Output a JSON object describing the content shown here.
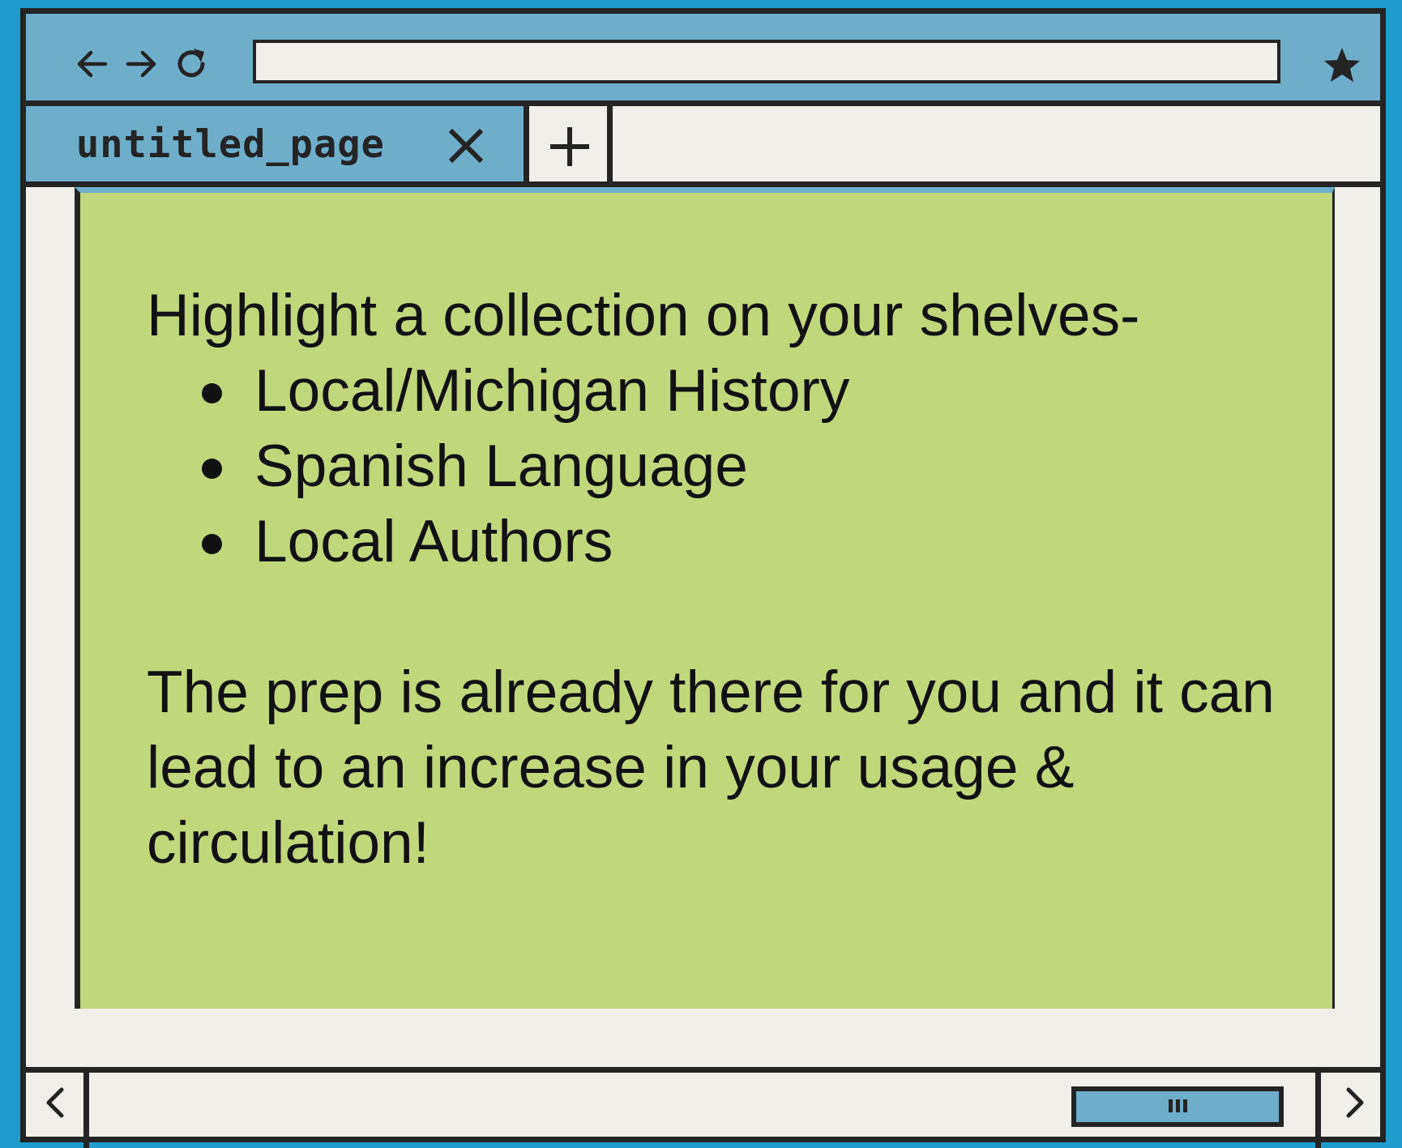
{
  "browser": {
    "address_bar": {
      "value": "",
      "placeholder": ""
    },
    "icons": {
      "back": "arrow-left-icon",
      "forward": "arrow-right-icon",
      "reload": "reload-icon",
      "bookmark": "star-icon",
      "close_tab": "close-icon",
      "new_tab": "plus-icon",
      "scroll_left": "chevron-left-icon",
      "scroll_right": "chevron-right-icon",
      "scroll_thumb_grip": "grip-icon"
    },
    "tabs": [
      {
        "label": "untitled_page",
        "active": true
      }
    ]
  },
  "content": {
    "heading": "Highlight a collection on your shelves-",
    "bullets": [
      "Local/Michigan History",
      "Spanish Language",
      "Local Authors"
    ],
    "paragraph": "The prep is already there for you and it can lead to an increase in your usage & circulation!"
  },
  "colors": {
    "background": "#1f9ccb",
    "chrome": "#6eaecb",
    "window_bg": "#f1efea",
    "content_bg": "#c0d77c",
    "border": "#242424"
  }
}
